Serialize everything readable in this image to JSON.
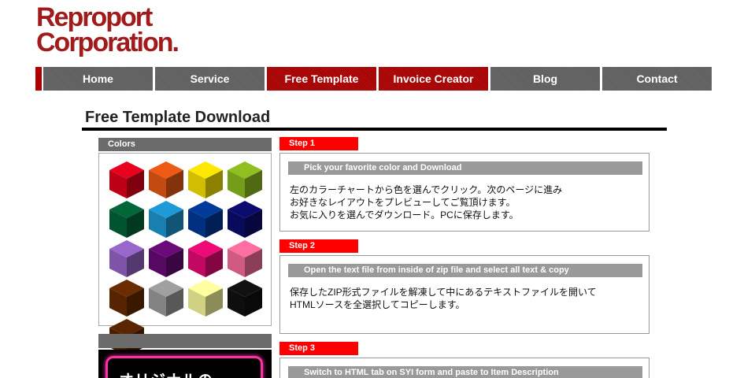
{
  "logo": {
    "line1": "Reproport",
    "line2": "Corporation."
  },
  "nav": {
    "items": [
      "Home",
      "Service",
      "Free Template",
      "Invoice Creator",
      "Blog",
      "Contact"
    ]
  },
  "page_title": "Free Template Download",
  "colors_panel": {
    "heading": "Colors",
    "swatches": [
      {
        "name": "red",
        "color": "#e8001c"
      },
      {
        "name": "orange",
        "color": "#ee5a14"
      },
      {
        "name": "yellow",
        "color": "#ffe800"
      },
      {
        "name": "lime",
        "color": "#90c020"
      },
      {
        "name": "green",
        "color": "#006838"
      },
      {
        "name": "sky-blue",
        "color": "#1e9bd7"
      },
      {
        "name": "blue",
        "color": "#003a9b"
      },
      {
        "name": "navy",
        "color": "#0c0c70"
      },
      {
        "name": "lavender",
        "color": "#9966cc"
      },
      {
        "name": "purple",
        "color": "#6a0a78"
      },
      {
        "name": "magenta",
        "color": "#ee0a76"
      },
      {
        "name": "pink",
        "color": "#ff6ea0"
      },
      {
        "name": "brown",
        "color": "#6a2c00"
      },
      {
        "name": "gray",
        "color": "#a0a0a0"
      },
      {
        "name": "cream",
        "color": "#ffffa0"
      },
      {
        "name": "black",
        "color": "#111111"
      },
      {
        "name": "dark-brown",
        "color": "#5a2600"
      }
    ]
  },
  "banner": {
    "text": "オリジナルの"
  },
  "steps": [
    {
      "tab": "Step 1",
      "subtitle": "Pick your favorite color and Download",
      "lines": [
        "左のカラーチャートから色を選んでクリック。次のページに進み",
        "お好きなレイアウトをプレビューしてご覧頂けます。",
        "お気に入りを選んでダウンロード。PCに保存します。"
      ]
    },
    {
      "tab": "Step 2",
      "subtitle": "Open the text file from inside of zip file and select all text & copy",
      "lines": [
        "保存したZIP形式ファイルを解凍して中にあるテキストファイルを開いて",
        "HTMLソースを全選択してコピーします。"
      ]
    },
    {
      "tab": "Step 3",
      "subtitle": "Switch to HTML tab on SYI form and paste to Item Description",
      "lines": []
    }
  ]
}
